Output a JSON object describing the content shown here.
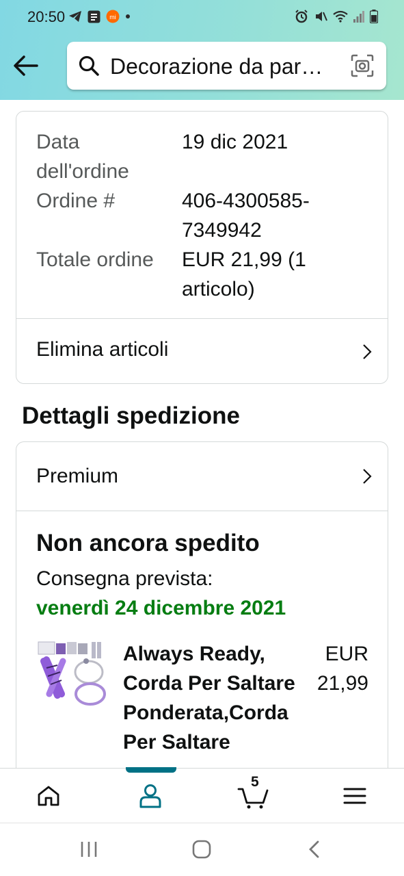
{
  "status_bar": {
    "time": "20:50"
  },
  "search": {
    "query": "Decorazione da par…"
  },
  "order_summary": {
    "rows": [
      {
        "label": "Data dell'ordine",
        "value": "19 dic 2021"
      },
      {
        "label": "Ordine #",
        "value": "406-4300585-7349942"
      },
      {
        "label": "Totale ordine",
        "value": "EUR 21,99 (1 articolo)"
      }
    ],
    "action_label": "Elimina articoli"
  },
  "shipping": {
    "section_title": "Dettagli spedizione",
    "method_label": "Premium",
    "status": "Non ancora spedito",
    "delivery_label": "Consegna prevista:",
    "delivery_date": "venerdì 24 dicembre 2021",
    "item": {
      "title": "Always Ready, Corda Per Saltare Ponderata,Corda Per Saltare",
      "price": "EUR 21,99"
    }
  },
  "bottom_nav": {
    "cart_count": "5",
    "items": [
      "home-icon",
      "account-icon",
      "cart-icon",
      "menu-icon"
    ]
  },
  "colors": {
    "delivery_green": "#067d12",
    "accent_teal": "#007185",
    "header_gradient_start": "#82d8e3",
    "header_gradient_end": "#a6e6cf"
  }
}
